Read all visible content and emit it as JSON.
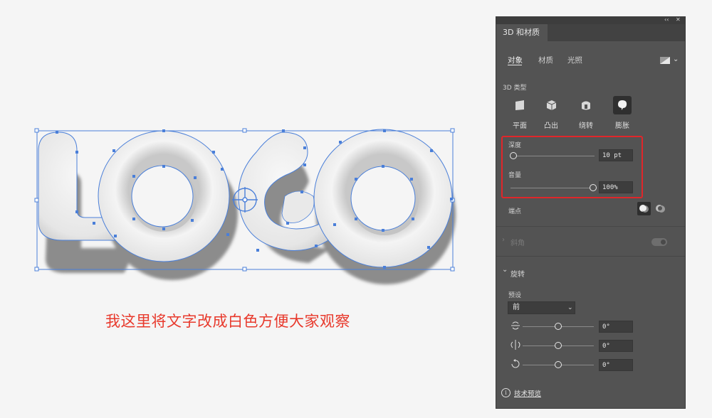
{
  "canvas": {
    "caption": "我这里将文字改成白色方便大家观察",
    "logo_text": "LOGO"
  },
  "panel": {
    "collapse_glyph": "‹‹",
    "close_glyph": "✕",
    "title": "3D 和材质",
    "tabs": [
      {
        "label": "对象",
        "active": true
      },
      {
        "label": "材质",
        "active": false
      },
      {
        "label": "光照",
        "active": false
      }
    ],
    "type_section_label": "3D 类型",
    "types": [
      {
        "label": "平面",
        "icon": "plane-icon",
        "selected": false
      },
      {
        "label": "凸出",
        "icon": "extrude-icon",
        "selected": false
      },
      {
        "label": "绕转",
        "icon": "revolve-icon",
        "selected": false
      },
      {
        "label": "膨胀",
        "icon": "inflate-icon",
        "selected": true
      }
    ],
    "depth": {
      "label": "深度",
      "value": "10 pt",
      "level": 0
    },
    "volume": {
      "label": "音量",
      "value": "100%",
      "level": 1
    },
    "caps_label": "端点",
    "bevel": {
      "label": "斜角",
      "chevron": "›",
      "enabled": false
    },
    "rotation": {
      "label": "旋转",
      "chevron": "⌄",
      "preset_label": "预设",
      "preset_value": "前",
      "x_value": "0°",
      "y_value": "0°",
      "z_value": "0°"
    },
    "tech_preview": {
      "label": "技术预览",
      "icon_glyph": "i"
    }
  },
  "colors": {
    "panel_bg": "#535353",
    "highlight": "#e0262a",
    "selection": "#4a7fd9",
    "caption": "#e8392c"
  }
}
